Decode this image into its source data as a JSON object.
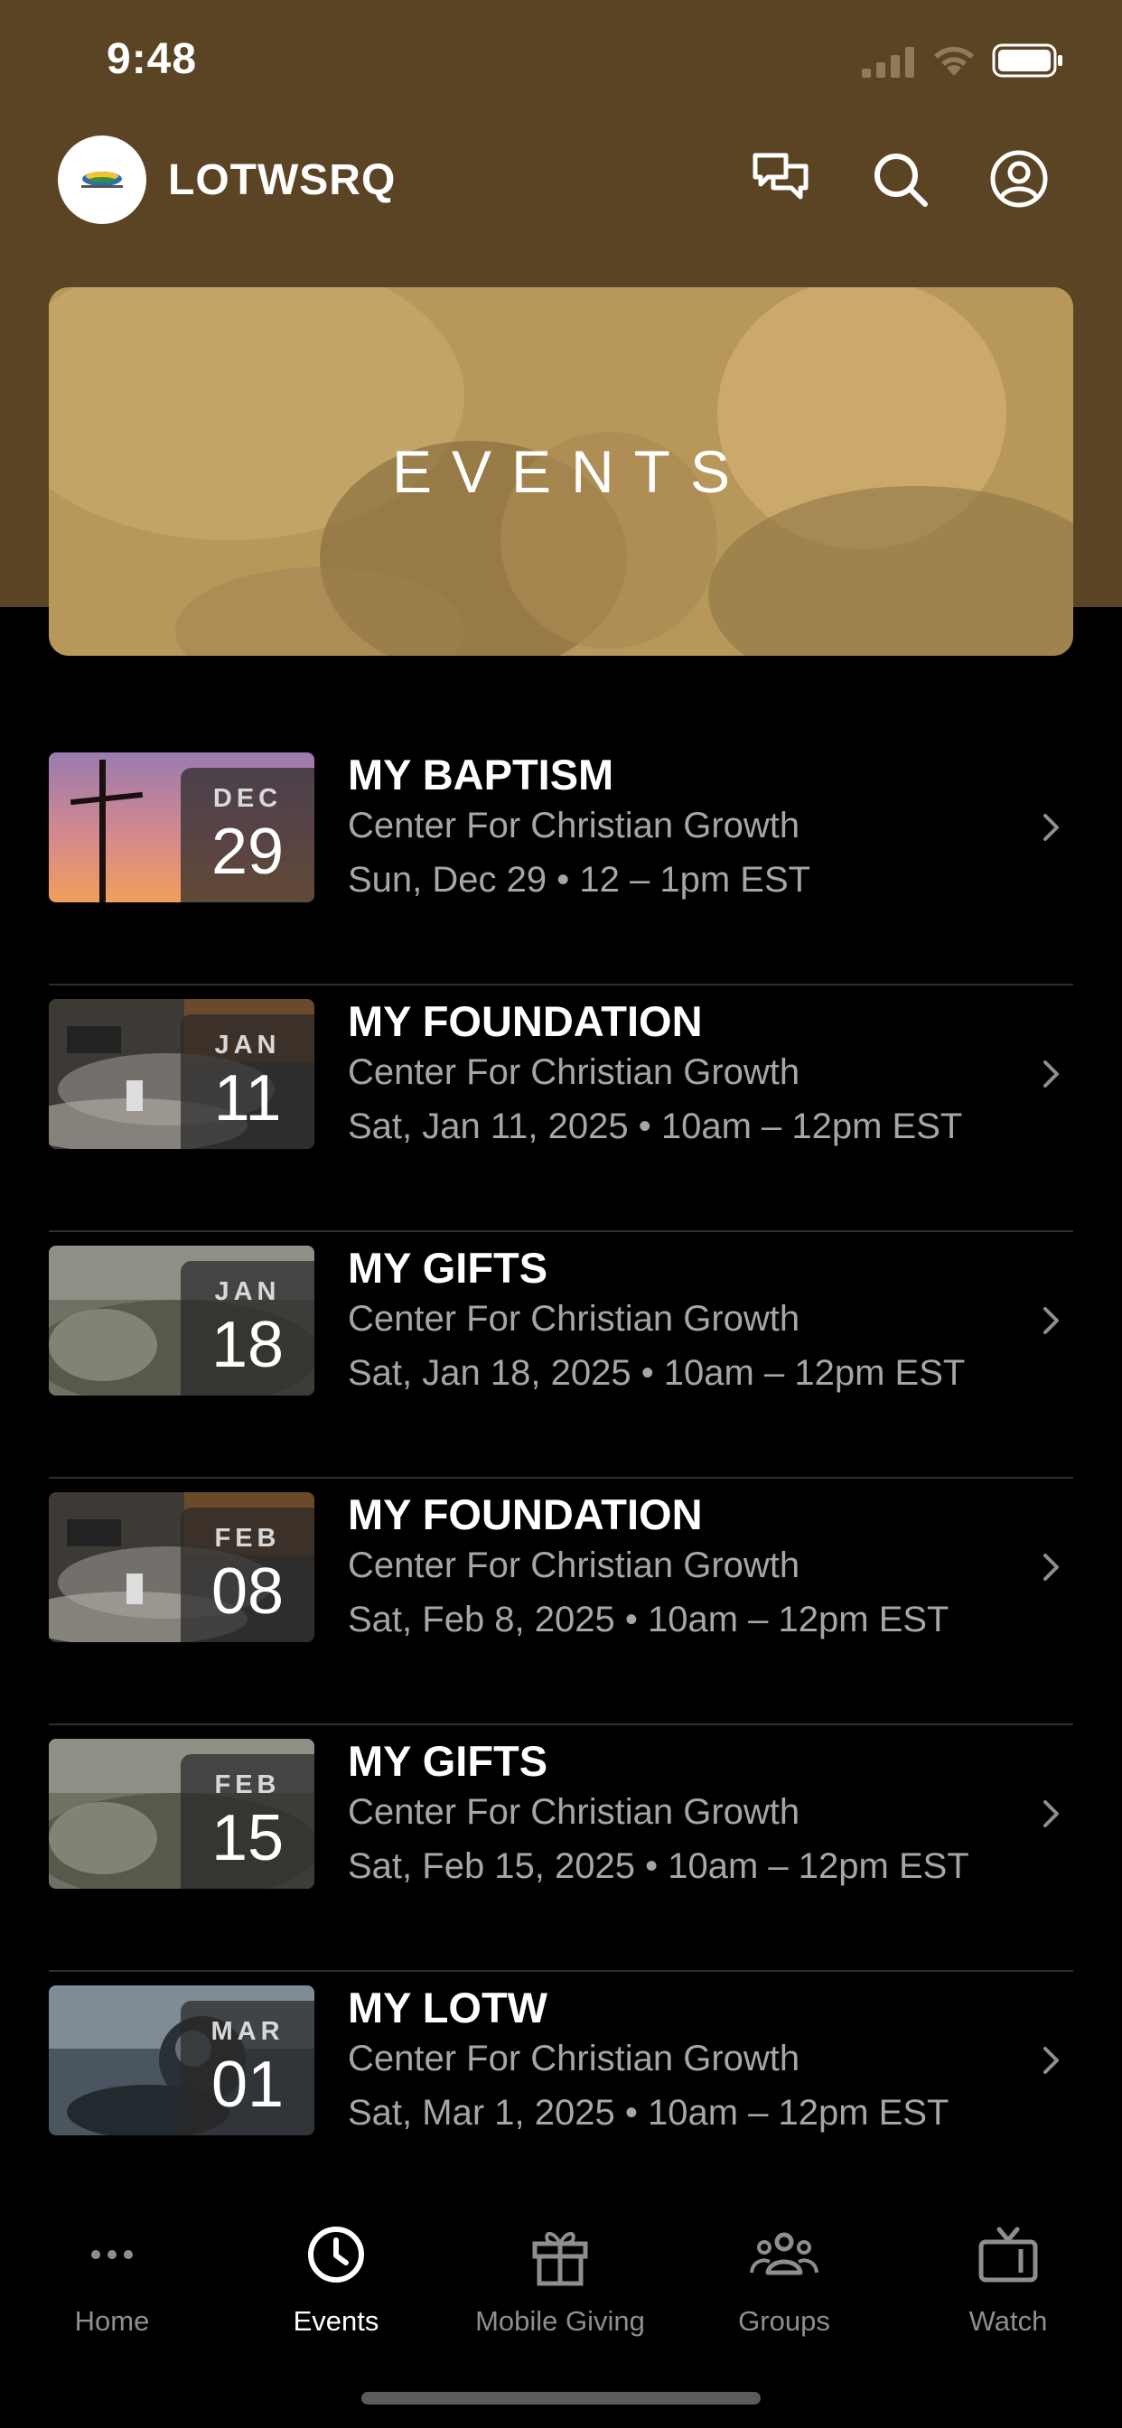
{
  "status_bar": {
    "time": "9:48"
  },
  "header": {
    "app_title": "LOTWSRQ",
    "icons": [
      "chat-icon",
      "search-icon",
      "profile-icon"
    ]
  },
  "hero": {
    "title": "EVENTS"
  },
  "events": [
    {
      "title": "MY BAPTISM",
      "location": "Center For Christian Growth",
      "time": "Sun, Dec 29 • 12 – 1pm EST",
      "month": "DEC",
      "day": "29",
      "image": "cross-sunset"
    },
    {
      "title": "MY FOUNDATION",
      "location": "Center For Christian Growth",
      "time": "Sat, Jan 11, 2025 • 10am – 12pm EST",
      "month": "JAN",
      "day": "11",
      "image": "living-room"
    },
    {
      "title": "MY GIFTS",
      "location": "Center For Christian Growth",
      "time": "Sat, Jan 18, 2025 • 10am – 12pm EST",
      "month": "JAN",
      "day": "18",
      "image": "grass-field"
    },
    {
      "title": "MY FOUNDATION",
      "location": "Center For Christian Growth",
      "time": "Sat, Feb 8, 2025 • 10am – 12pm EST",
      "month": "FEB",
      "day": "08",
      "image": "living-room"
    },
    {
      "title": "MY GIFTS",
      "location": "Center For Christian Growth",
      "time": "Sat, Feb 15, 2025 • 10am – 12pm EST",
      "month": "FEB",
      "day": "15",
      "image": "grass-field"
    },
    {
      "title": "MY LOTW",
      "location": "Center For Christian Growth",
      "time": "Sat, Mar 1, 2025 • 10am – 12pm EST",
      "month": "MAR",
      "day": "01",
      "image": "glass-sphere"
    }
  ],
  "tabbar": {
    "tabs": [
      {
        "label": "Home",
        "icon": "more-dots-icon",
        "active": false
      },
      {
        "label": "Events",
        "icon": "clock-icon",
        "active": true
      },
      {
        "label": "Mobile Giving",
        "icon": "gift-icon",
        "active": false
      },
      {
        "label": "Groups",
        "icon": "groups-icon",
        "active": false
      },
      {
        "label": "Watch",
        "icon": "tv-icon",
        "active": false
      }
    ]
  },
  "colors": {
    "header_bg": "#5b4423",
    "hero_tint": "#b8985a",
    "accent_text": "#ffffff",
    "muted_text": "#a6a6a6",
    "inactive_tab": "#8e8e8e"
  }
}
